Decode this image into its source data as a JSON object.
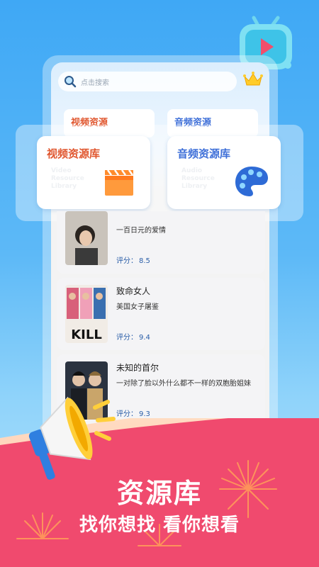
{
  "search": {
    "placeholder": "点击搜索"
  },
  "tabs": {
    "video_small": "视频资源",
    "audio_small": "音频资源"
  },
  "cards": {
    "video": {
      "title": "视频资源库",
      "subtitle": "Video Resource Library"
    },
    "audio": {
      "title": "音频资源库",
      "subtitle": "Audio Resource Library"
    }
  },
  "movies": [
    {
      "title": "",
      "desc": "一百日元的爱情",
      "score_label": "评分：",
      "score": "8.5",
      "poster_icon": "poster-portrait"
    },
    {
      "title": "致命女人",
      "desc": "美国女子屠鉴",
      "score_label": "评分：",
      "score": "9.4",
      "poster_icon": "poster-kill",
      "poster_text": "KILL"
    },
    {
      "title": "未知的首尔",
      "desc": "一对除了脸以外什么都不一样的双胞胎姐妹",
      "score_label": "评分：",
      "score": "9.3",
      "poster_icon": "poster-duo"
    }
  ],
  "banner": {
    "title": "资源库",
    "subtitle": "找你想找 看你想看"
  },
  "colors": {
    "video_accent": "#e0562e",
    "audio_accent": "#3e6fd8",
    "banner_red": "#f04a6e"
  }
}
